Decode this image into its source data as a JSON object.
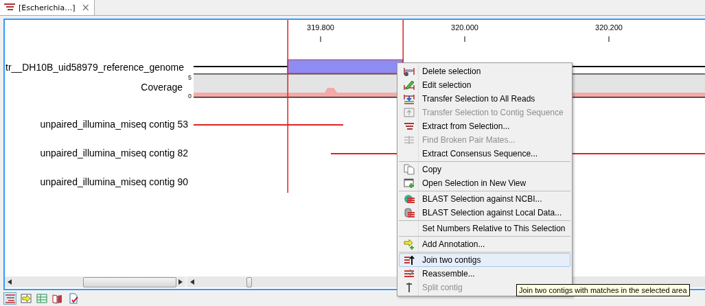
{
  "tab": {
    "label": "[Escherichia…]",
    "close": "×"
  },
  "ruler": {
    "ticks": [
      "319.800",
      "320.000",
      "320.200"
    ]
  },
  "tracks": [
    {
      "kind": "genome",
      "label": "tr__DH10B_uid58979_reference_genome"
    },
    {
      "kind": "coverage",
      "label": "Coverage",
      "max": "5",
      "min": "0"
    },
    {
      "kind": "contig",
      "label": "unpaired_illumina_miseq contig 53"
    },
    {
      "kind": "contig",
      "label": "unpaired_illumina_miseq contig 82"
    },
    {
      "kind": "contig",
      "label": "unpaired_illumina_miseq contig 90"
    }
  ],
  "context_menu": [
    {
      "kind": "item",
      "label": "Delete selection",
      "disabled": false,
      "highlighted": false
    },
    {
      "kind": "item",
      "label": "Edit selection",
      "disabled": false,
      "highlighted": false
    },
    {
      "kind": "item",
      "label": "Transfer Selection to All Reads",
      "disabled": false,
      "highlighted": false
    },
    {
      "kind": "item",
      "label": "Transfer Selection to Contig Sequence",
      "disabled": true,
      "highlighted": false
    },
    {
      "kind": "item",
      "label": "Extract from Selection...",
      "disabled": false,
      "highlighted": false
    },
    {
      "kind": "item",
      "label": "Find Broken Pair Mates...",
      "disabled": true,
      "highlighted": false
    },
    {
      "kind": "item",
      "label": "Extract Consensus Sequence...",
      "disabled": false,
      "highlighted": false
    },
    {
      "kind": "separator"
    },
    {
      "kind": "item",
      "label": "Copy",
      "disabled": false,
      "highlighted": false
    },
    {
      "kind": "item",
      "label": "Open Selection in New View",
      "disabled": false,
      "highlighted": false
    },
    {
      "kind": "separator"
    },
    {
      "kind": "item",
      "label": "BLAST Selection against NCBI...",
      "disabled": false,
      "highlighted": false
    },
    {
      "kind": "item",
      "label": "BLAST Selection against Local Data...",
      "disabled": false,
      "highlighted": false
    },
    {
      "kind": "separator"
    },
    {
      "kind": "item",
      "label": "Set Numbers Relative to This Selection",
      "disabled": false,
      "highlighted": false
    },
    {
      "kind": "separator"
    },
    {
      "kind": "item",
      "label": "Add Annotation...",
      "disabled": false,
      "highlighted": false
    },
    {
      "kind": "separator"
    },
    {
      "kind": "item",
      "label": "Join two contigs",
      "disabled": false,
      "highlighted": true
    },
    {
      "kind": "item",
      "label": "Reassemble...",
      "disabled": false,
      "highlighted": false
    },
    {
      "kind": "item",
      "label": "Split contig",
      "disabled": true,
      "highlighted": false
    }
  ],
  "tooltip": {
    "text": "Join two contigs with matches in the selected area"
  },
  "view_buttons": [
    {
      "selected": true
    },
    {
      "selected": false
    },
    {
      "selected": false
    },
    {
      "selected": false
    },
    {
      "selected": false
    }
  ]
}
